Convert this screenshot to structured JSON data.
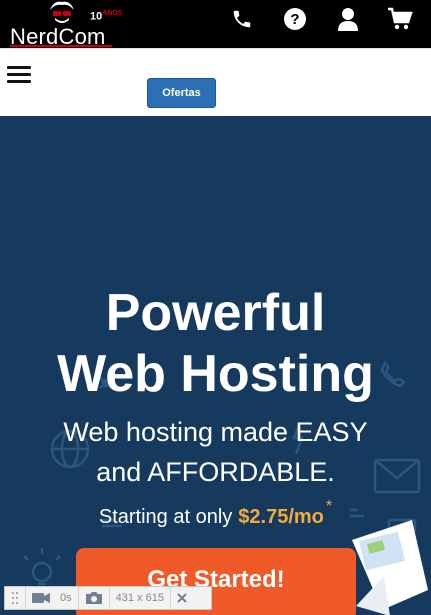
{
  "header": {
    "brand_name": "NerdCom",
    "brand_badge": "10",
    "icons": [
      "phone-icon",
      "help-icon",
      "user-icon",
      "cart-icon"
    ]
  },
  "nav": {
    "offers_label": "Ofertas"
  },
  "hero": {
    "title_line1": "Powerful",
    "title_line2": "Web Hosting",
    "subtitle_line1": "Web hosting made EASY",
    "subtitle_line2": "and AFFORDABLE.",
    "price_prefix": "Starting at only",
    "price": "$2.75/mo",
    "price_mark": "*",
    "cta_label": "Get Started!"
  },
  "devtools": {
    "timer": "0s",
    "viewport": "431 x 615"
  },
  "colors": {
    "header_bg": "#000000",
    "hero_bg": "#163a5d",
    "offers_button": "#2c6fb4",
    "cta_button": "#f05a28",
    "price_accent": "#f6a93b"
  }
}
